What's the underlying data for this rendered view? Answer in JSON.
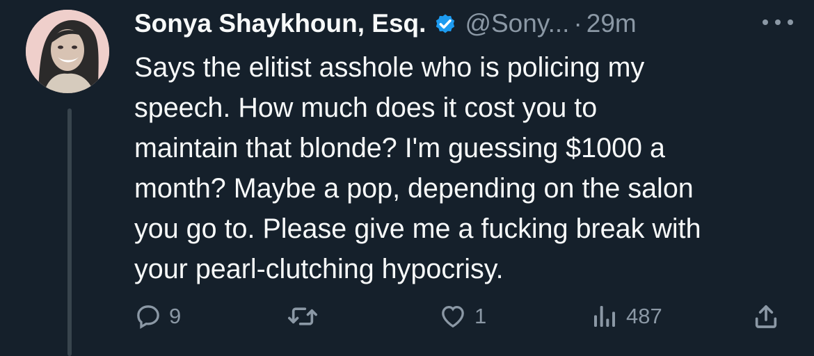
{
  "tweet": {
    "author_name": "Sonya Shaykhoun, Esq.",
    "handle": "@Sony...",
    "separator": "·",
    "time": "29m",
    "verified": true,
    "text": "Says the elitist asshole who is policing my\nspeech. How much does it cost you to\nmaintain that blonde? I'm guessing $1000 a\nmonth? Maybe a pop, depending on the salon\nyou go to. Please give me a fucking break with\nyour pearl-clutching hypocrisy.",
    "actions": {
      "reply_count": "9",
      "retweet_count": "",
      "like_count": "1",
      "views_count": "487"
    }
  },
  "icons": {
    "verified": "verified-badge-icon",
    "more": "more-dots-icon",
    "reply": "reply-bubble-icon",
    "retweet": "retweet-icon",
    "like": "heart-icon",
    "views": "views-bar-icon",
    "share": "share-icon"
  },
  "colors": {
    "background": "#15202b",
    "text": "#f7f9f9",
    "secondary": "#8b98a5",
    "verified": "#1d9bf0",
    "thread_line": "#38444d"
  }
}
